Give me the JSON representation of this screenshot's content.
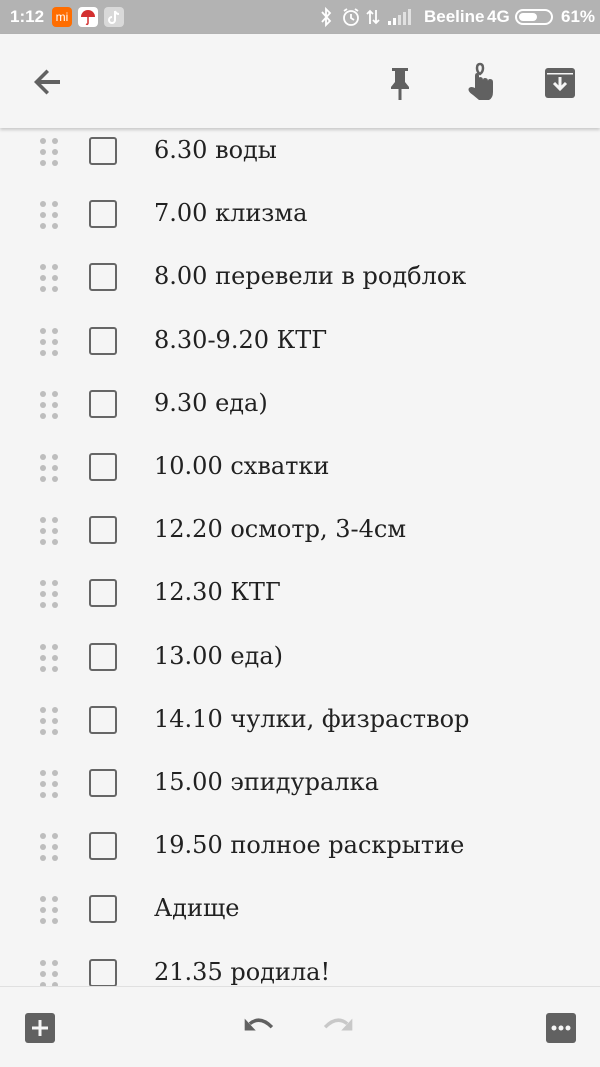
{
  "status_bar": {
    "time": "1:12",
    "carrier": "Beeline",
    "network": "4G",
    "battery_percent": "61%",
    "battery_level": 0.61,
    "icons": [
      "mi-icon",
      "umbrella-app-icon",
      "tiktok-icon",
      "bluetooth-icon",
      "alarm-icon",
      "data-arrows-icon",
      "signal-icon"
    ]
  },
  "toolbar": {
    "back_icon": "back-arrow-icon",
    "pin_icon": "pin-icon",
    "reminder_icon": "reminder-icon",
    "archive_icon": "archive-icon"
  },
  "list": {
    "items": [
      {
        "text": "6.30 воды",
        "checked": false
      },
      {
        "text": "7.00 клизма",
        "checked": false
      },
      {
        "text": "8.00 перевели в родблок",
        "checked": false
      },
      {
        "text": "8.30-9.20 КТГ",
        "checked": false
      },
      {
        "text": "9.30 еда)",
        "checked": false
      },
      {
        "text": "10.00 схватки",
        "checked": false
      },
      {
        "text": "12.20 осмотр, 3-4см",
        "checked": false
      },
      {
        "text": "12.30 КТГ",
        "checked": false
      },
      {
        "text": "13.00 еда)",
        "checked": false
      },
      {
        "text": "14.10 чулки, физраствор",
        "checked": false
      },
      {
        "text": "15.00 эпидуралка",
        "checked": false
      },
      {
        "text": "19.50 полное раскрытие",
        "checked": false
      },
      {
        "text": "Адище",
        "checked": false
      },
      {
        "text": "21.35 родила!",
        "checked": false
      }
    ]
  },
  "bottom_bar": {
    "add_icon": "add-box-icon",
    "undo_icon": "undo-icon",
    "redo_icon": "redo-icon",
    "more_icon": "more-icon"
  },
  "colors": {
    "background": "#f5f5f5",
    "status_bar": "#b3b3b3",
    "icon": "#616161",
    "text": "#212121"
  }
}
